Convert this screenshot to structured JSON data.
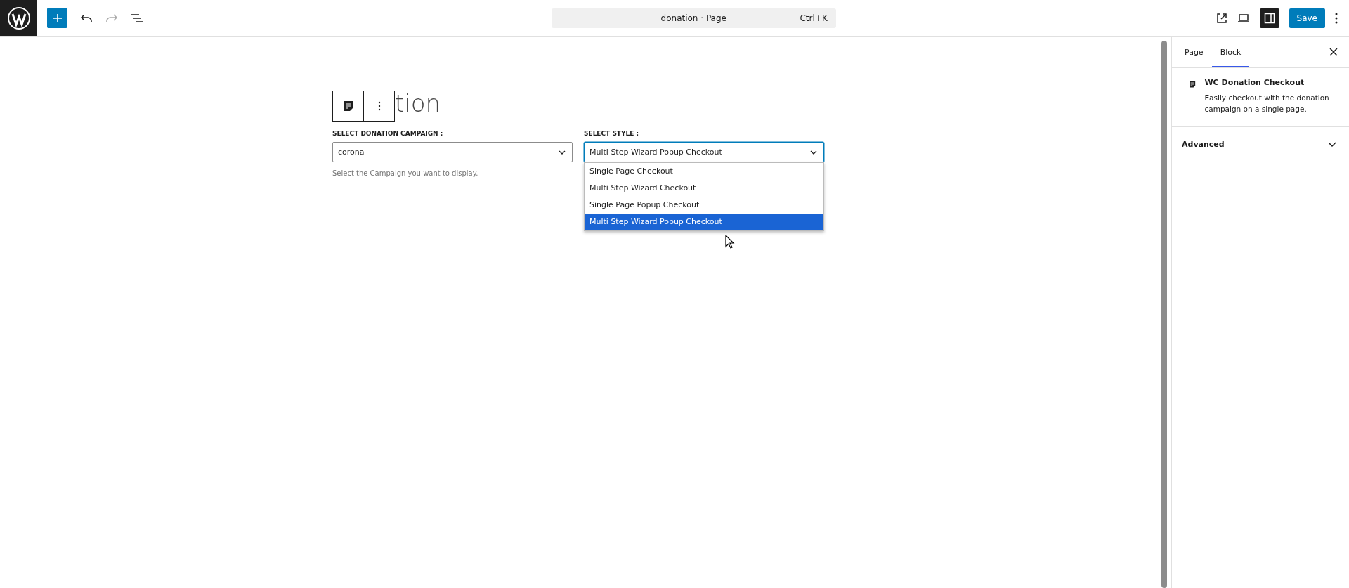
{
  "header": {
    "document_title": "donation · Page",
    "shortcut": "Ctrl+K",
    "save": "Save",
    "redo_disabled": true,
    "settings_panel_open": true
  },
  "editor": {
    "heading_visible": "tion",
    "fields": [
      {
        "label": "SELECT DONATION CAMPAIGN :",
        "value": "corona",
        "help": "Select the Campaign you want to display.",
        "focused": false
      },
      {
        "label": "SELECT STYLE :",
        "value": "Multi Step Wizard Popup Checkout",
        "focused": true
      }
    ],
    "style_options": [
      {
        "label": "Single Page Checkout",
        "selected": false
      },
      {
        "label": "Multi Step Wizard Checkout",
        "selected": false
      },
      {
        "label": "Single Page Popup Checkout",
        "selected": false
      },
      {
        "label": "Multi Step Wizard Popup Checkout",
        "selected": true
      }
    ]
  },
  "sidebar": {
    "tabs": [
      {
        "label": "Page",
        "selected": false
      },
      {
        "label": "Block",
        "selected": true
      }
    ],
    "block": {
      "title": "WC Donation Checkout",
      "description": "Easily checkout with the donation campaign on a single page."
    },
    "panels": [
      {
        "label": "Advanced",
        "expanded": false
      }
    ]
  }
}
